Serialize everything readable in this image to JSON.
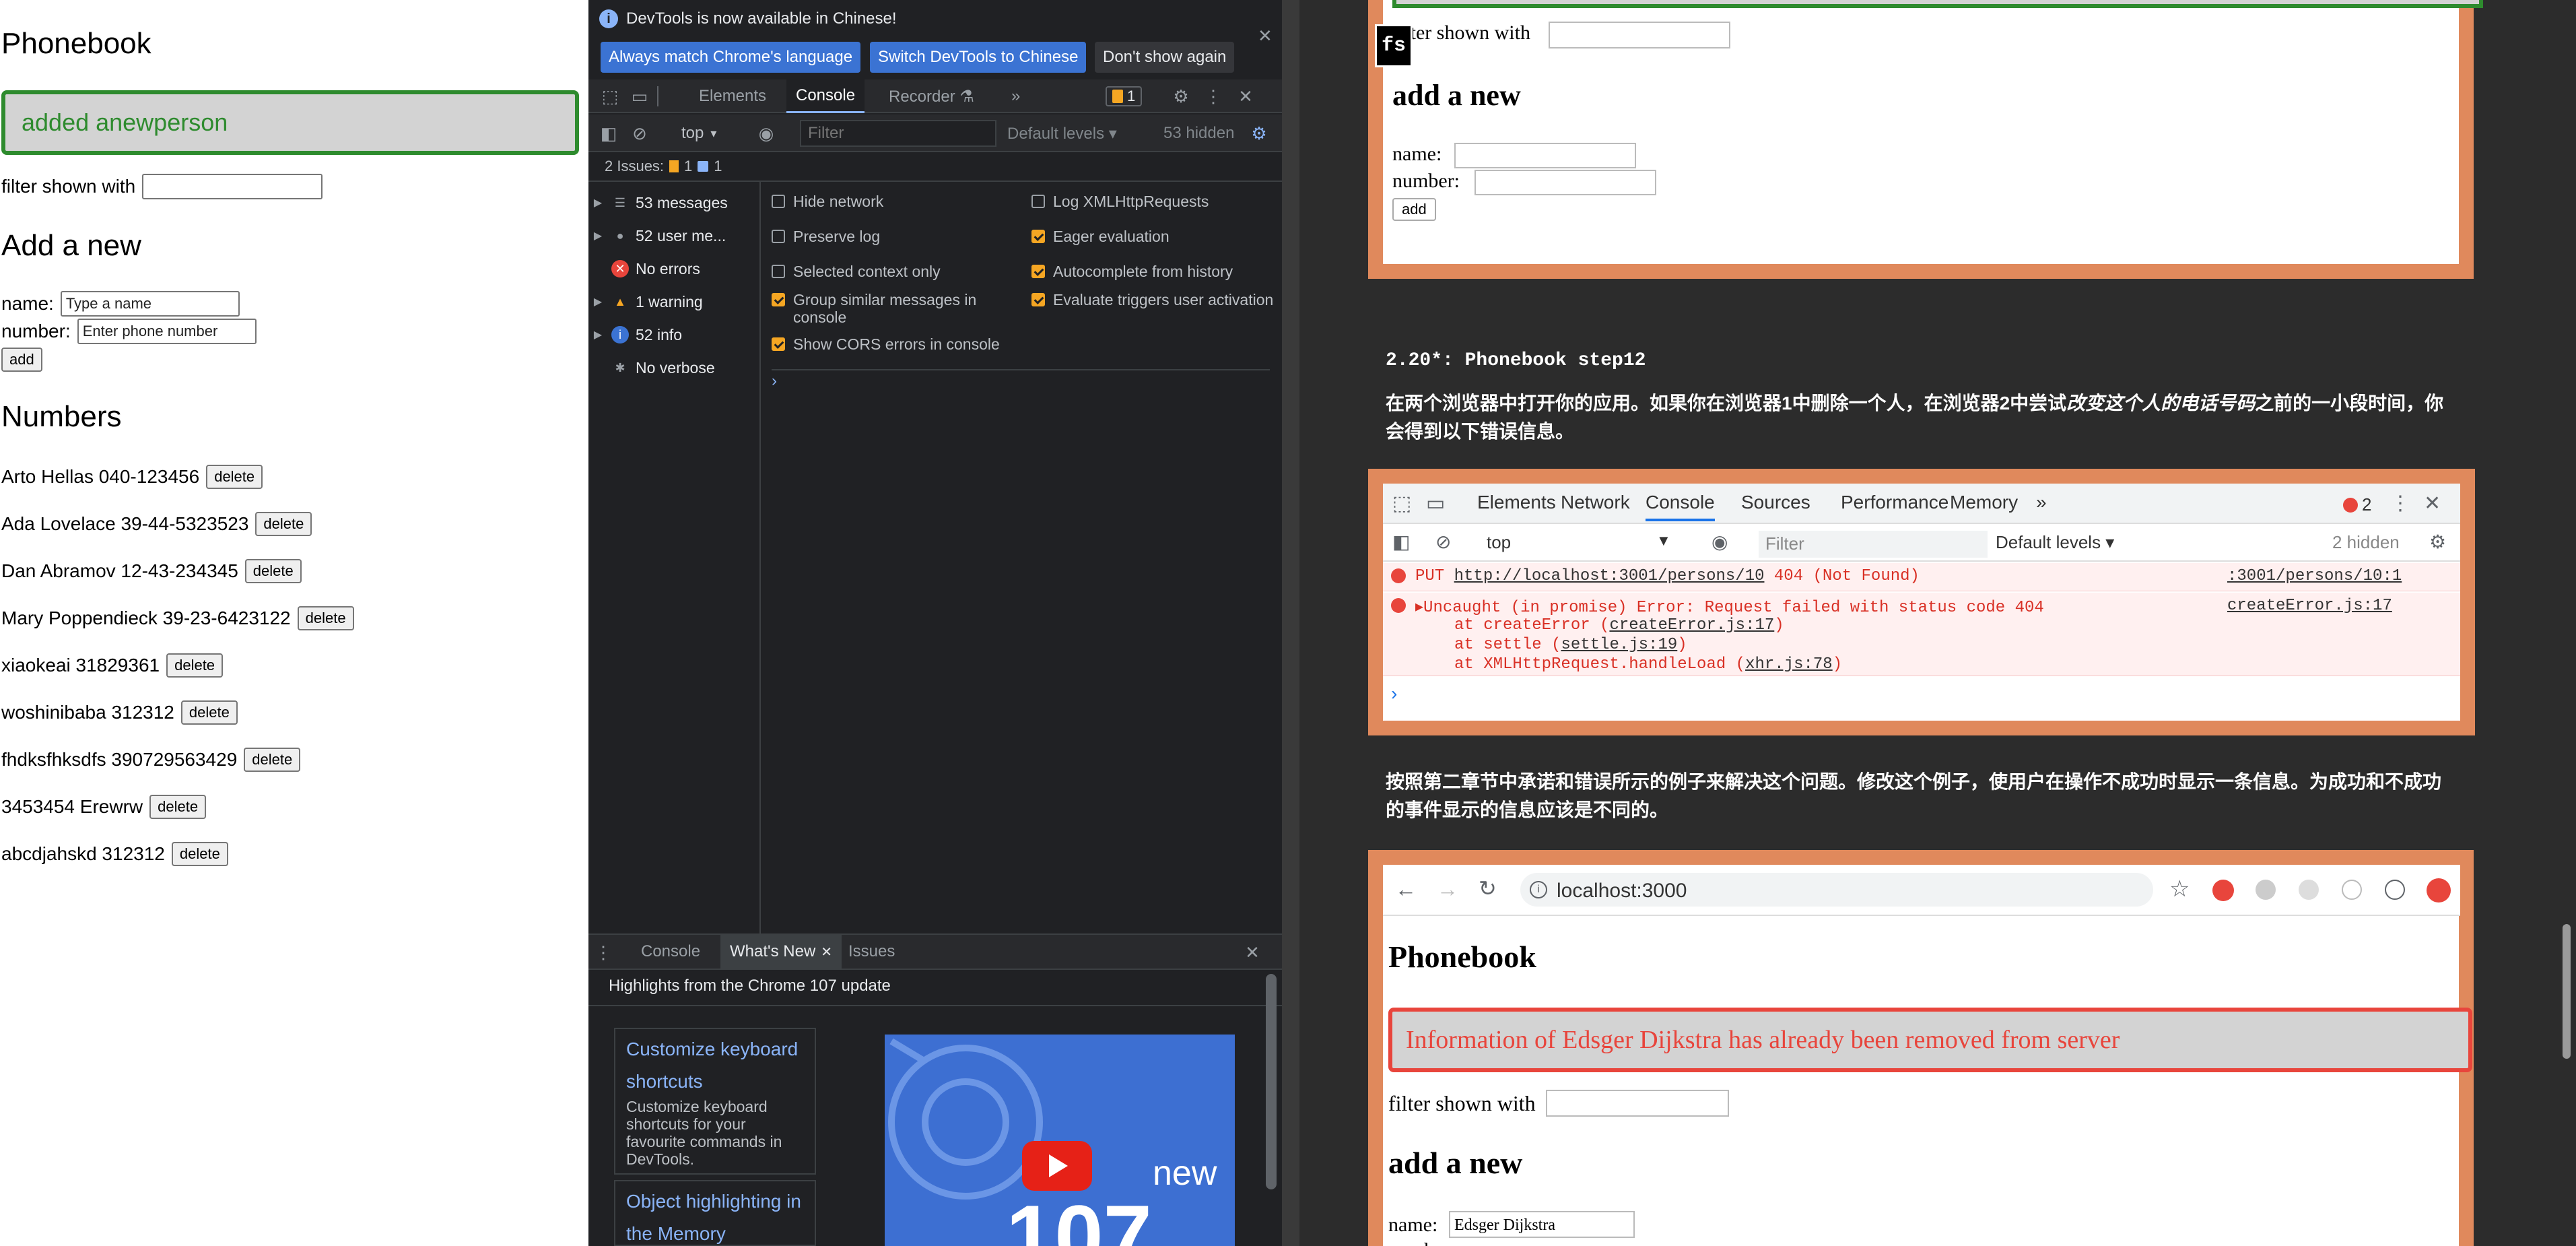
{
  "app": {
    "title": "Phonebook",
    "notification": "added anewperson",
    "filter_label": "filter shown with",
    "filter_value": "",
    "add_heading": "Add a new",
    "name_label": "name:",
    "name_placeholder": "Type a name",
    "number_label": "number:",
    "number_placeholder": "Enter phone number",
    "add_button": "add",
    "numbers_heading": "Numbers",
    "delete_label": "delete",
    "persons": [
      "Arto Hellas 040-123456",
      "Ada Lovelace 39-44-5323523",
      "Dan Abramov 12-43-234345",
      "Mary Poppendieck 39-23-6423122",
      "xiaokeai 31829361",
      "woshinibaba 312312",
      "fhdksfhksdfs 390729563429",
      "3453454 Erewrw",
      "abcdjahskd 312312"
    ]
  },
  "devtools": {
    "banner_text": "DevTools is now available in Chinese!",
    "btn_match_language": "Always match Chrome's language",
    "btn_switch_chinese": "Switch DevTools to Chinese",
    "btn_dont_show": "Don't show again",
    "tabs": [
      "Elements",
      "Console",
      "Recorder ⚗",
      "»"
    ],
    "issues_badge": "1",
    "context": "top",
    "filter_placeholder": "Filter",
    "default_levels": "Default levels ▾",
    "hidden_count": "53 hidden",
    "issues_bar": "2 Issues:",
    "issues_warn_count": "1",
    "issues_info_count": "1",
    "sidebar": [
      {
        "label": "53 messages",
        "icon": "list-icon",
        "expandable": true
      },
      {
        "label": "52 user me...",
        "icon": "user-icon",
        "expandable": true
      },
      {
        "label": "No errors",
        "icon": "error-icon",
        "expandable": false
      },
      {
        "label": "1 warning",
        "icon": "warning-icon",
        "expandable": true
      },
      {
        "label": "52 info",
        "icon": "info-icon",
        "expandable": true
      },
      {
        "label": "No verbose",
        "icon": "bug-icon",
        "expandable": false
      }
    ],
    "settings_left": [
      {
        "label": "Hide network",
        "checked": false
      },
      {
        "label": "Preserve log",
        "checked": false
      },
      {
        "label": "Selected context only",
        "checked": false
      },
      {
        "label": "Group similar messages in console",
        "checked": true
      },
      {
        "label": "Show CORS errors in console",
        "checked": true
      }
    ],
    "settings_right": [
      {
        "label": "Log XMLHttpRequests",
        "checked": false
      },
      {
        "label": "Eager evaluation",
        "checked": true
      },
      {
        "label": "Autocomplete from history",
        "checked": true
      },
      {
        "label": "Evaluate triggers user activation",
        "checked": true
      }
    ],
    "drawer_tabs": [
      "Console",
      "What's New",
      "Issues"
    ],
    "whats_new_header": "Highlights from the Chrome 107 update",
    "card1_title": "Customize keyboard shortcuts",
    "card1_desc": "Customize keyboard shortcuts for your favourite commands in DevTools.",
    "card2_title": "Object highlighting in the Memory",
    "video_text": "new",
    "video_number": "107",
    "colors": {
      "accent_blue": "#3b73d3",
      "warning": "#f5a623",
      "error": "#e8453c"
    }
  },
  "article": {
    "fs_badge": "fs",
    "top_filter_label": "filter shown with",
    "top_add_heading": "add a new",
    "top_name_label": "name:",
    "top_number_label": "number:",
    "top_add_button": "add",
    "section_title": "2.20*: Phonebook step12",
    "para1_a": "在两个浏览器中打开你的应用。如果你在浏览器1中删除一个人，在浏览器2中尝试",
    "para1_em": "改变这个人的电话号码",
    "para1_b": "之前的一小段时间，你会得到以下错误信息。",
    "shot_tabs": [
      "Elements",
      "Network",
      "Console",
      "Sources",
      "Performance",
      "Memory",
      "»"
    ],
    "shot_error_count": "2",
    "shot_context": "top",
    "shot_filter_placeholder": "Filter",
    "shot_default_levels": "Default levels ▾",
    "shot_hidden": "2 hidden",
    "err1_method": "PUT",
    "err1_url": "http://localhost:3001/persons/10",
    "err1_status": "404 (Not Found)",
    "err1_source": ":3001/persons/10:1",
    "err2_msg": "Uncaught (in promise) Error: Request failed with status code 404",
    "err2_source": "createError.js:17",
    "stack": [
      {
        "fn": "at createError (",
        "file": "createError.js:17",
        "end": ")"
      },
      {
        "fn": "at settle (",
        "file": "settle.js:19",
        "end": ")"
      },
      {
        "fn": "at XMLHttpRequest.handleLoad (",
        "file": "xhr.js:78",
        "end": ")"
      }
    ],
    "para2": "按照第二章节中承诺和错误所示的例子来解决这个问题。修改这个例子，使用户在操作不成功时显示一条信息。为成功和不成功的事件显示的信息应该是不同的。",
    "browser_url": "localhost:3000",
    "browser_title": "Phonebook",
    "browser_notification": "Information of Edsger Dijkstra has already been removed from server",
    "browser_filter_label": "filter shown with",
    "browser_add_heading": "add a new",
    "browser_name_label": "name:",
    "browser_name_value": "Edsger Dijkstra",
    "browser_number_label": "number:"
  }
}
